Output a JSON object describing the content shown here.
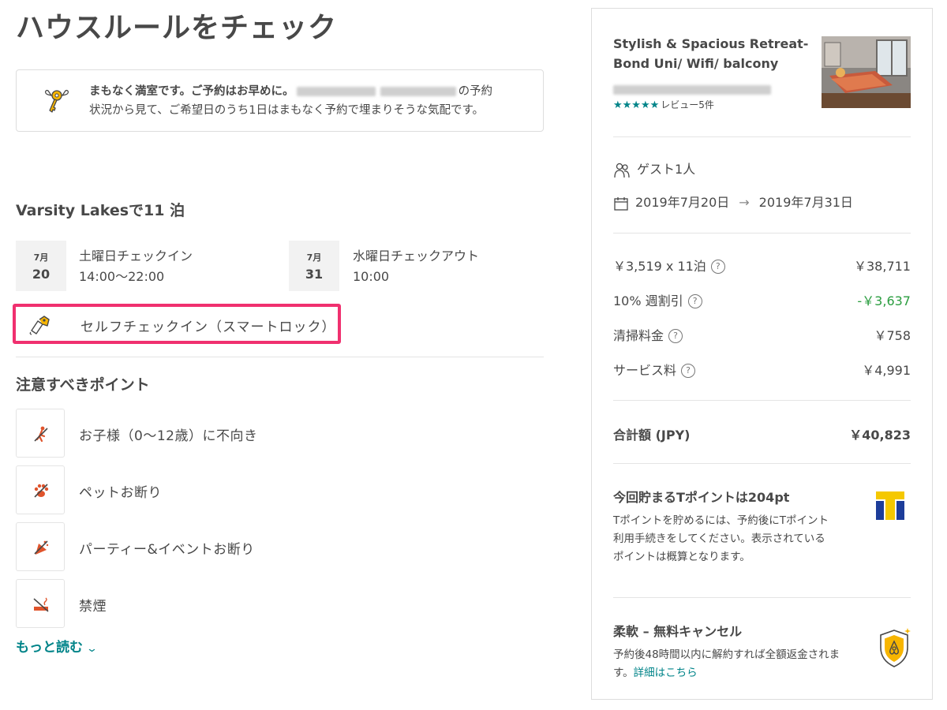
{
  "page": {
    "title": "ハウスルールをチェック"
  },
  "notice": {
    "icon": "key-with-wings-icon",
    "bold_text": "まもなく満室です。ご予約はお早めに。",
    "text_after_blur": "の予約",
    "second_line": "状況から見て、ご希望日のうち1日はまもなく予約で埋まりそうな気配です。"
  },
  "stay": {
    "heading": "Varsity Lakesで11 泊",
    "checkin": {
      "month": "7月",
      "day": "20",
      "label": "土曜日チェックイン",
      "time": "14:00〜22:00"
    },
    "checkout": {
      "month": "7月",
      "day": "31",
      "label": "水曜日チェックアウト",
      "time": "10:00"
    },
    "self_checkin": {
      "icon": "smart-lock-icon",
      "label": "セルフチェックイン（スマートロック）",
      "highlight_color": "#f0306f"
    }
  },
  "points": {
    "heading": "注意すべきポイント",
    "items": [
      {
        "icon": "no-children-icon",
        "label": "お子様（0〜12歳）に不向き"
      },
      {
        "icon": "no-pets-icon",
        "label": "ペットお断り"
      },
      {
        "icon": "no-parties-icon",
        "label": "パーティー&イベントお断り"
      },
      {
        "icon": "no-smoking-icon",
        "label": "禁煙"
      }
    ],
    "more_link": "もっと読む",
    "accent_color": "#008489"
  },
  "listing": {
    "title": "Stylish & Spacious Retreat- Bond Uni/ Wifi/ balcony",
    "stars": "★★★★★",
    "reviews": "レビュー5件",
    "thumbnail": "bedroom-photo"
  },
  "booking": {
    "guests": "ゲスト1人",
    "guests_icon": "guests-icon",
    "calendar_icon": "calendar-icon",
    "date_from": "2019年7月20日",
    "arrow": "→",
    "date_to": "2019年7月31日"
  },
  "prices": {
    "nightly_label": "￥3,519 x 11泊",
    "nightly_value": "￥38,711",
    "discount_label": "10% 週割引",
    "discount_value": "-￥3,637",
    "cleaning_label": "清掃料金",
    "cleaning_value": "￥758",
    "service_label": "サービス料",
    "service_value": "￥4,991",
    "help_mark": "?",
    "total_label": "合計額 (JPY)",
    "total_value": "￥40,823",
    "discount_color": "#2a9d3f"
  },
  "tpoint": {
    "title": "今回貯まるTポイントは204pt",
    "body": "Tポイントを貯めるには、予約後にTポイント利用手続きをしてください。表示されているポイントは概算となります。",
    "logo": "t-point-logo"
  },
  "cancel": {
    "title": "柔軟 – 無料キャンセル",
    "body": "予約後48時間以内に解約すれば全額返金されます。",
    "link": "詳細はこちら",
    "icon": "shield-icon"
  }
}
